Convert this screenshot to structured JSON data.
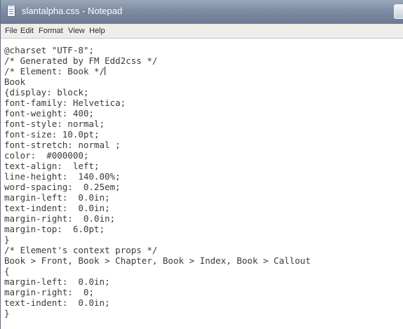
{
  "window": {
    "title": "slantalpha.css - Notepad"
  },
  "menu": {
    "items": [
      "File",
      "Edit",
      "Format",
      "View",
      "Help"
    ]
  },
  "editor": {
    "lines": [
      "@charset \"UTF-8\";",
      "/* Generated by FM Edd2css */",
      "/* Element: Book */",
      "Book",
      "{display: block;",
      "font-family: Helvetica;",
      "font-weight: 400;",
      "font-style: normal;",
      "font-size: 10.0pt;",
      "font-stretch: normal ;",
      "color:  #000000;",
      "text-align:  left;",
      "line-height:  140.00%;",
      "word-spacing:  0.25em;",
      "margin-left:  0.0in;",
      "text-indent:  0.0in;",
      "margin-right:  0.0in;",
      "margin-top:  6.0pt;",
      "}",
      "/* Element's context props */",
      "Book > Front, Book > Chapter, Book > Index, Book > Callout",
      "{",
      "margin-left:  0.0in;",
      "margin-right:  0;",
      "text-indent:  0.0in;",
      "}"
    ]
  }
}
